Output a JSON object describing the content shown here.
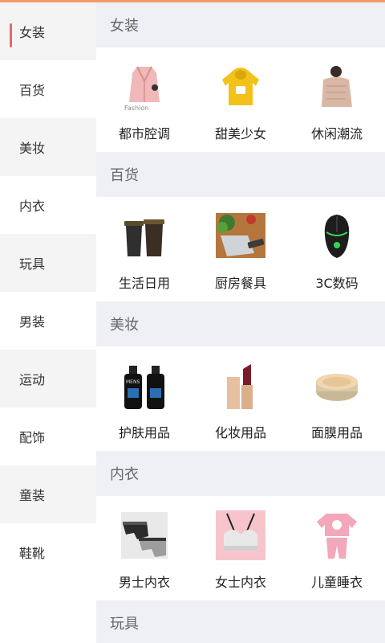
{
  "sidebar": {
    "items": [
      {
        "label": "女装"
      },
      {
        "label": "百货"
      },
      {
        "label": "美妆"
      },
      {
        "label": "内衣"
      },
      {
        "label": "玩具"
      },
      {
        "label": "男装"
      },
      {
        "label": "运动"
      },
      {
        "label": "配饰"
      },
      {
        "label": "童装"
      },
      {
        "label": "鞋靴"
      }
    ],
    "active_index": 0
  },
  "sections": [
    {
      "title": "女装",
      "items": [
        {
          "label": "都市腔调",
          "icon": "pink-coat-icon",
          "thumb_text": "Fashion"
        },
        {
          "label": "甜美少女",
          "icon": "yellow-hoodie-icon"
        },
        {
          "label": "休闲潮流",
          "icon": "knit-sweater-icon"
        }
      ]
    },
    {
      "title": "百货",
      "items": [
        {
          "label": "生活日用",
          "icon": "trash-bins-icon"
        },
        {
          "label": "厨房餐具",
          "icon": "cleaver-knife-icon"
        },
        {
          "label": "3C数码",
          "icon": "gaming-mouse-icon"
        }
      ]
    },
    {
      "title": "美妆",
      "items": [
        {
          "label": "护肤用品",
          "icon": "pump-bottles-icon",
          "thumb_text": "MENS"
        },
        {
          "label": "化妆用品",
          "icon": "lipstick-icon"
        },
        {
          "label": "面膜用品",
          "icon": "cream-jar-icon"
        }
      ]
    },
    {
      "title": "内衣",
      "items": [
        {
          "label": "男士内衣",
          "icon": "mens-underwear-icon"
        },
        {
          "label": "女士内衣",
          "icon": "bra-icon"
        },
        {
          "label": "儿童睡衣",
          "icon": "kids-pajamas-icon"
        }
      ]
    },
    {
      "title": "玩具",
      "items": []
    }
  ],
  "colors": {
    "accent": "#e26a6a",
    "top_line": "#f39a6b",
    "header_bg": "#eef0f5",
    "sidebar_alt_bg": "#f4f4f4"
  }
}
